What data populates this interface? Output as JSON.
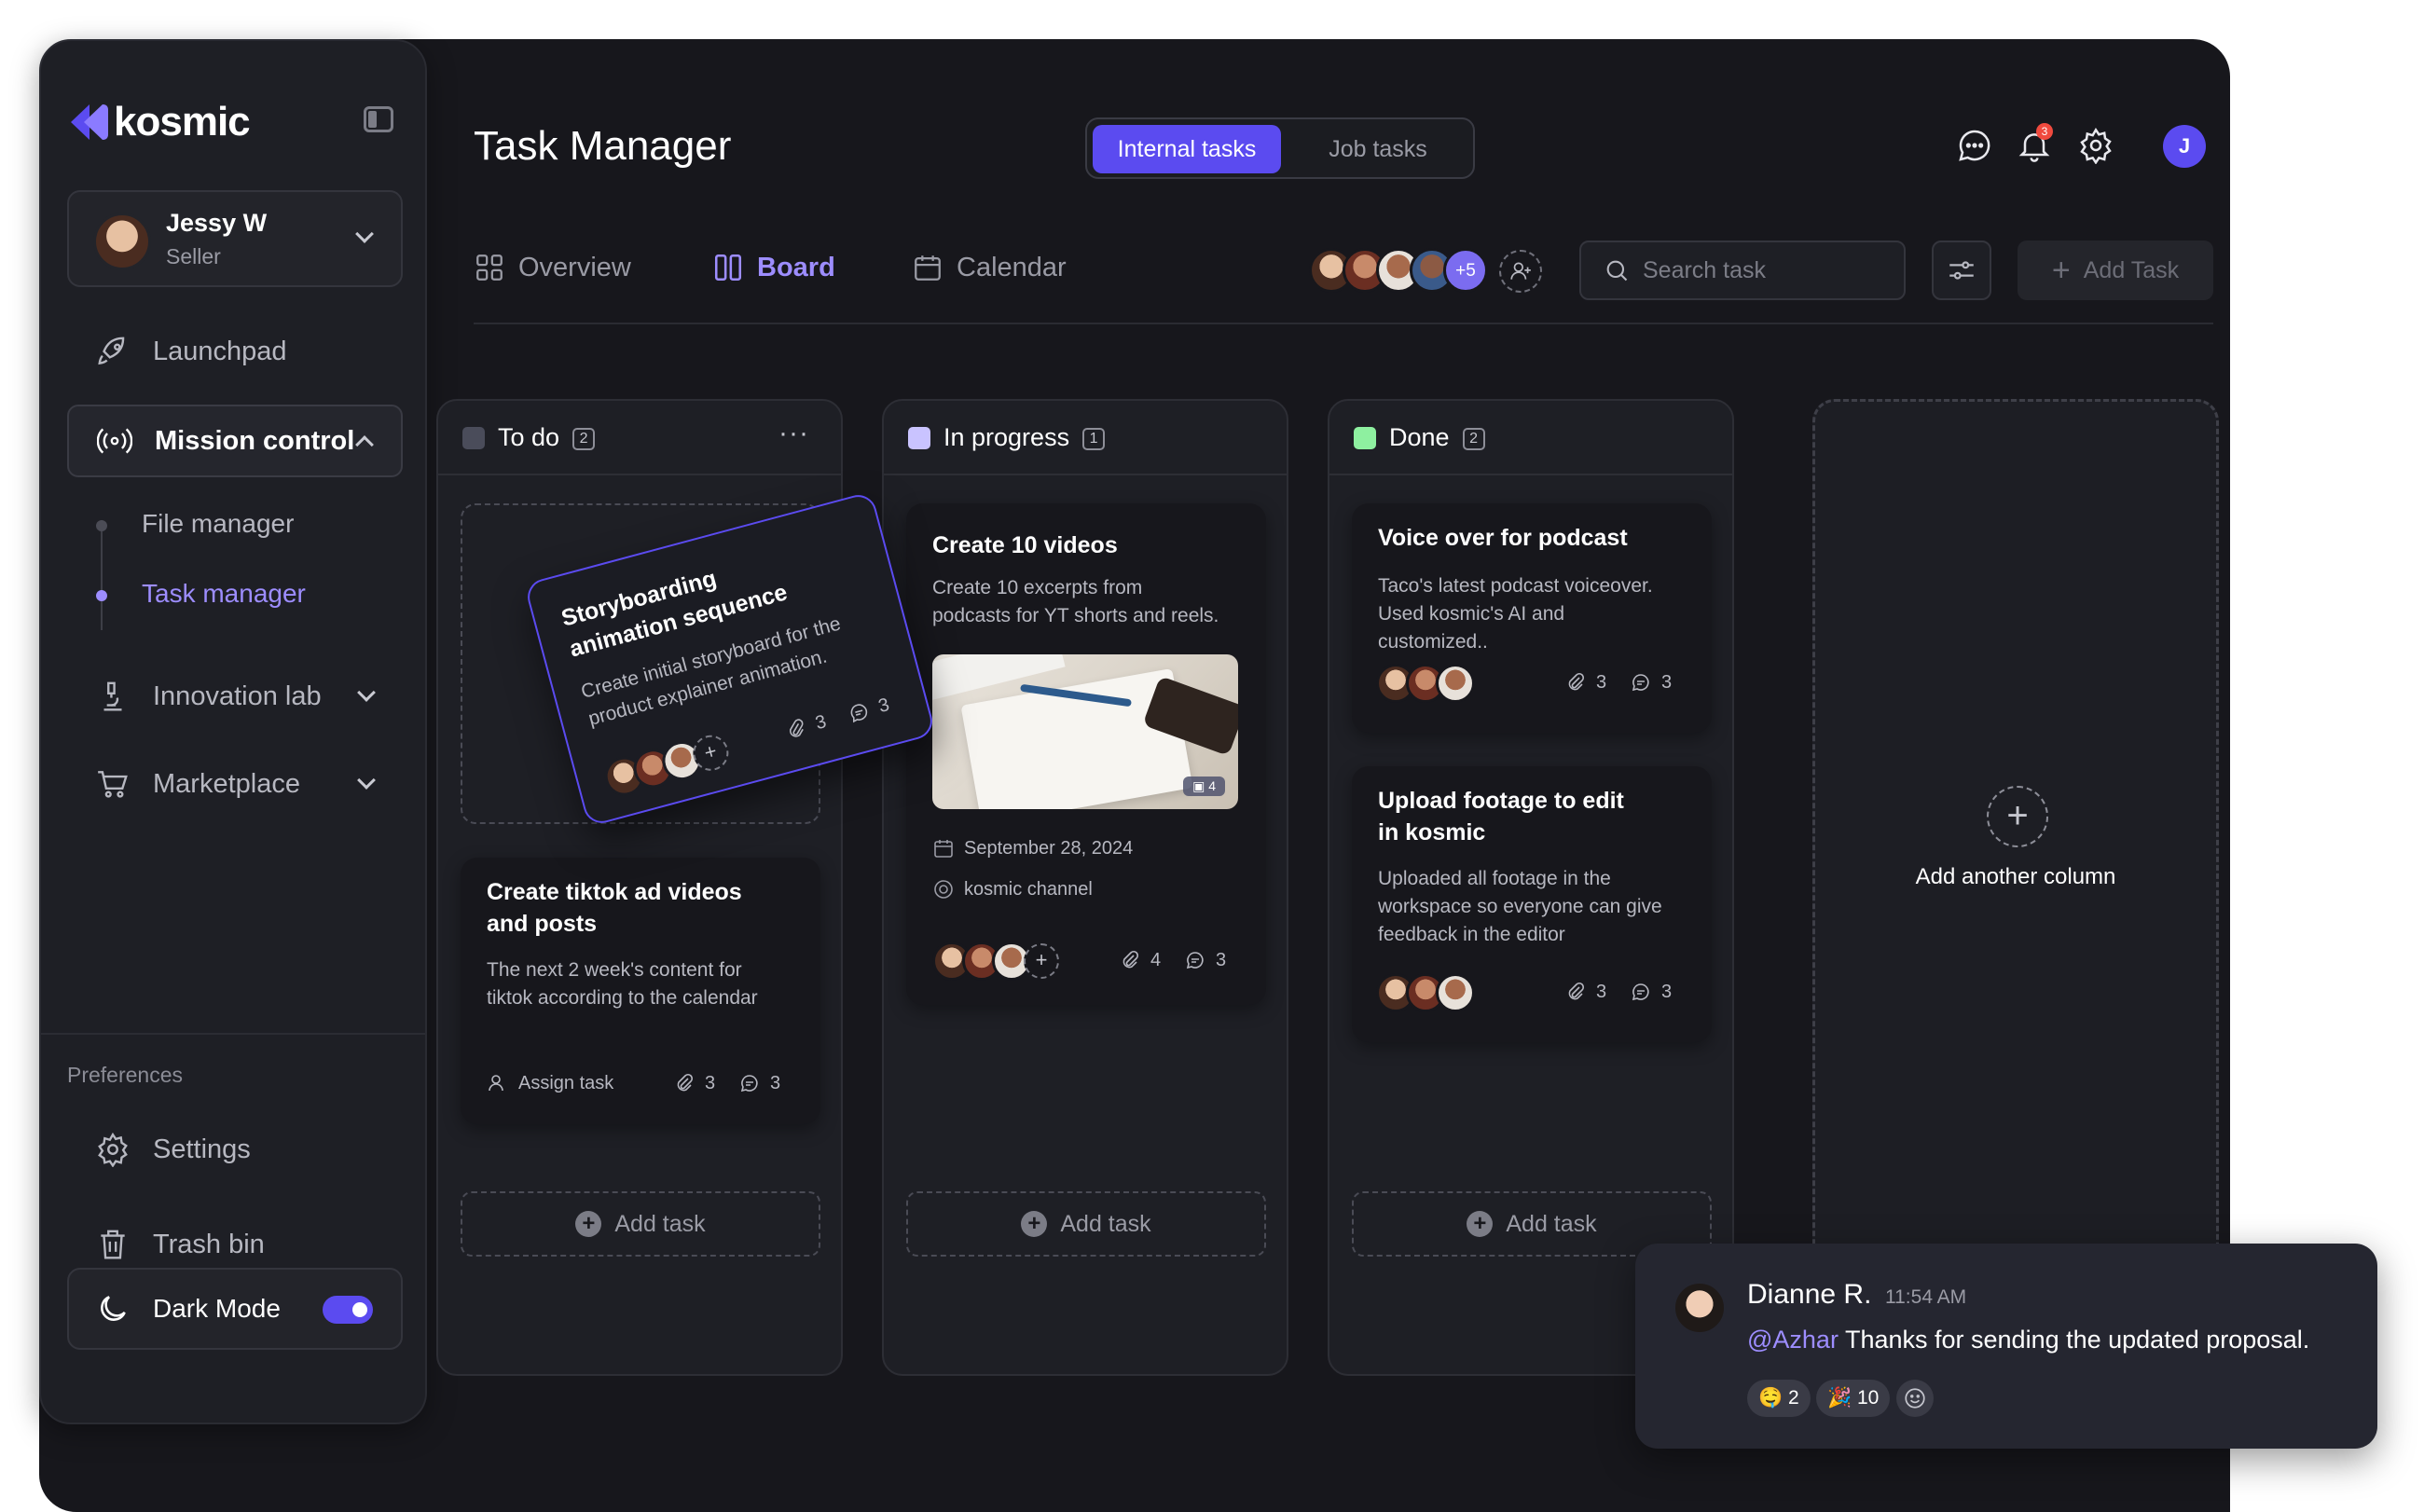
{
  "app": {
    "logo_text": "kosmic"
  },
  "user": {
    "name": "Jessy W",
    "role": "Seller"
  },
  "sidebar": {
    "launchpad": "Launchpad",
    "mission_control": "Mission control",
    "sub_items": [
      "File manager",
      "Task manager"
    ],
    "innovation_lab": "Innovation lab",
    "marketplace": "Marketplace",
    "preferences_label": "Preferences",
    "settings": "Settings",
    "trash": "Trash bin",
    "dark_mode": "Dark Mode",
    "dark_mode_on": true
  },
  "header": {
    "title": "Task Manager",
    "segment": {
      "active": "Internal tasks",
      "inactive": "Job tasks"
    },
    "notification_count": "3",
    "me_initial": "J"
  },
  "views": {
    "overview": "Overview",
    "board": "Board",
    "calendar": "Calendar"
  },
  "members": {
    "more": "+5"
  },
  "toolbar": {
    "search_placeholder": "Search task",
    "add_task": "Add Task"
  },
  "columns": [
    {
      "title": "To do",
      "count": "2",
      "color": "#4a4c5a",
      "add_label": "Add task",
      "drag_card": {
        "title_line1": "Storyboarding",
        "title_line2": "animation sequence",
        "desc_line1": "Create initial storyboard for the",
        "desc_line2": "product explainer animation.",
        "attachments": "3",
        "comments": "3"
      },
      "card": {
        "title_line1": "Create tiktok ad videos",
        "title_line2": "and posts",
        "desc_line1": "The next 2 week's content for",
        "desc_line2": "tiktok according to the calendar",
        "assign": "Assign task",
        "attachments": "3",
        "comments": "3"
      }
    },
    {
      "title": "In progress",
      "count": "1",
      "color": "#c9c3ff",
      "add_label": "Add task",
      "card": {
        "title": "Create 10 videos",
        "desc_line1": "Create 10 excerpts from",
        "desc_line2": "podcasts for YT shorts and reels.",
        "photo_count": "4",
        "date": "September 28, 2024",
        "channel": "kosmic channel",
        "attachments": "4",
        "comments": "3"
      }
    },
    {
      "title": "Done",
      "count": "2",
      "color": "#8ef0a0",
      "add_label": "Add task",
      "cards": [
        {
          "title": "Voice over for podcast",
          "desc_line1": "Taco's latest podcast voiceover.",
          "desc_line2": "Used kosmic's AI and",
          "desc_line3": "customized..",
          "attachments": "3",
          "comments": "3"
        },
        {
          "title_line1": "Upload footage to edit",
          "title_line2": "in kosmic",
          "desc_line1": "Uploaded all footage in the",
          "desc_line2": "workspace so everyone can give",
          "desc_line3": "feedback in the editor",
          "attachments": "3",
          "comments": "3"
        }
      ]
    }
  ],
  "add_column": "Add another column",
  "chat": {
    "name": "Dianne R.",
    "time": "11:54 AM",
    "mention": "@Azhar",
    "message": " Thanks for sending the updated proposal.",
    "reactions": [
      {
        "emoji": "🤤",
        "count": "2"
      },
      {
        "emoji": "🎉",
        "count": "10"
      }
    ]
  },
  "colors": {
    "accent": "#5b4bf0",
    "accent_text": "#9d8dff",
    "background": "#17171c"
  }
}
